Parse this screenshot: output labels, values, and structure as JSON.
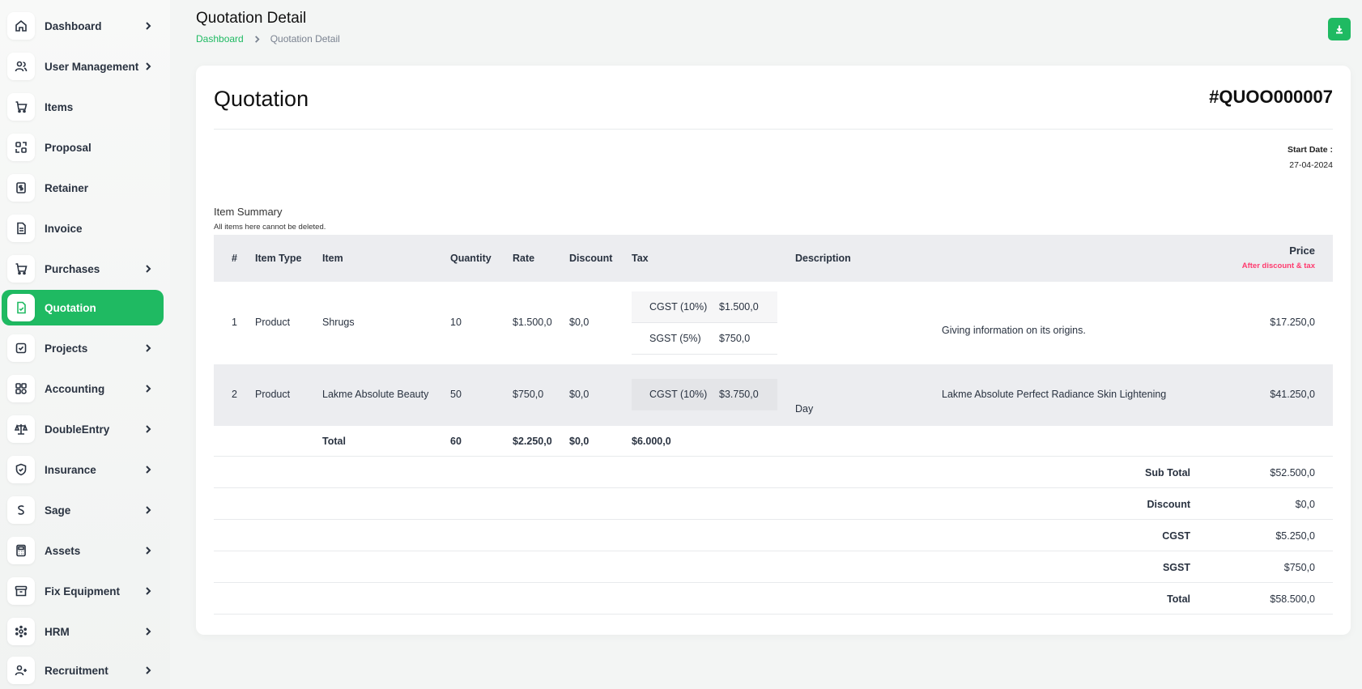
{
  "sidebar": {
    "items": [
      {
        "label": "Dashboard",
        "icon": "home-icon",
        "has_arrow": true
      },
      {
        "label": "User Management",
        "icon": "users-icon",
        "has_arrow": true
      },
      {
        "label": "Items",
        "icon": "cart-icon",
        "has_arrow": false
      },
      {
        "label": "Proposal",
        "icon": "exchange-icon",
        "has_arrow": false
      },
      {
        "label": "Retainer",
        "icon": "dollar-file-icon",
        "has_arrow": false
      },
      {
        "label": "Invoice",
        "icon": "file-icon",
        "has_arrow": false
      },
      {
        "label": "Purchases",
        "icon": "cart-icon",
        "has_arrow": true
      },
      {
        "label": "Quotation",
        "icon": "file-check-icon",
        "has_arrow": false,
        "active": true
      },
      {
        "label": "Projects",
        "icon": "checkbox-icon",
        "has_arrow": true
      },
      {
        "label": "Accounting",
        "icon": "grid-icon",
        "has_arrow": true
      },
      {
        "label": "DoubleEntry",
        "icon": "scale-icon",
        "has_arrow": true
      },
      {
        "label": "Insurance",
        "icon": "shield-icon",
        "has_arrow": true
      },
      {
        "label": "Sage",
        "icon": "s-letter-icon",
        "has_arrow": true
      },
      {
        "label": "Assets",
        "icon": "calculator-icon",
        "has_arrow": true
      },
      {
        "label": "Fix Equipment",
        "icon": "archive-icon",
        "has_arrow": true
      },
      {
        "label": "HRM",
        "icon": "network-icon",
        "has_arrow": true
      },
      {
        "label": "Recruitment",
        "icon": "user-plus-icon",
        "has_arrow": true
      }
    ]
  },
  "header": {
    "title": "Quotation Detail",
    "breadcrumb": {
      "link": "Dashboard",
      "current": "Quotation Detail"
    }
  },
  "quotation": {
    "title": "Quotation",
    "number": "#QUOO000007",
    "start_date_label": "Start Date :",
    "start_date": "27-04-2024",
    "summary_title": "Item Summary",
    "summary_note": "All items here cannot be deleted."
  },
  "table": {
    "headers": {
      "num": "#",
      "item_type": "Item Type",
      "item": "Item",
      "quantity": "Quantity",
      "rate": "Rate",
      "discount": "Discount",
      "tax": "Tax",
      "description": "Description",
      "price": "Price",
      "price_sub": "After discount & tax"
    },
    "rows": [
      {
        "num": "1",
        "item_type": "Product",
        "item": "Shrugs",
        "quantity": "10",
        "rate": "$1.500,0",
        "discount": "$0,0",
        "taxes": [
          {
            "name": "CGST (10%)",
            "value": "$1.500,0"
          },
          {
            "name": "SGST (5%)",
            "value": "$750,0"
          }
        ],
        "description": "",
        "description2": "Giving information on its origins.",
        "price": "$17.250,0"
      },
      {
        "num": "2",
        "item_type": "Product",
        "item": "Lakme Absolute Beauty",
        "quantity": "50",
        "rate": "$750,0",
        "discount": "$0,0",
        "taxes": [
          {
            "name": "CGST (10%)",
            "value": "$3.750,0"
          }
        ],
        "description": "Day",
        "description2": "Lakme Absolute Perfect Radiance Skin Lightening",
        "price": "$41.250,0"
      }
    ],
    "total": {
      "label": "Total",
      "quantity": "60",
      "rate": "$2.250,0",
      "discount": "$0,0",
      "tax": "$6.000,0"
    }
  },
  "summary": [
    {
      "label": "Sub Total",
      "value": "$52.500,0"
    },
    {
      "label": "Discount",
      "value": "$0,0"
    },
    {
      "label": "CGST",
      "value": "$5.250,0"
    },
    {
      "label": "SGST",
      "value": "$750,0"
    },
    {
      "label": "Total",
      "value": "$58.500,0"
    }
  ],
  "colors": {
    "accent": "#1fba62",
    "price_note": "#ff3a6e"
  }
}
